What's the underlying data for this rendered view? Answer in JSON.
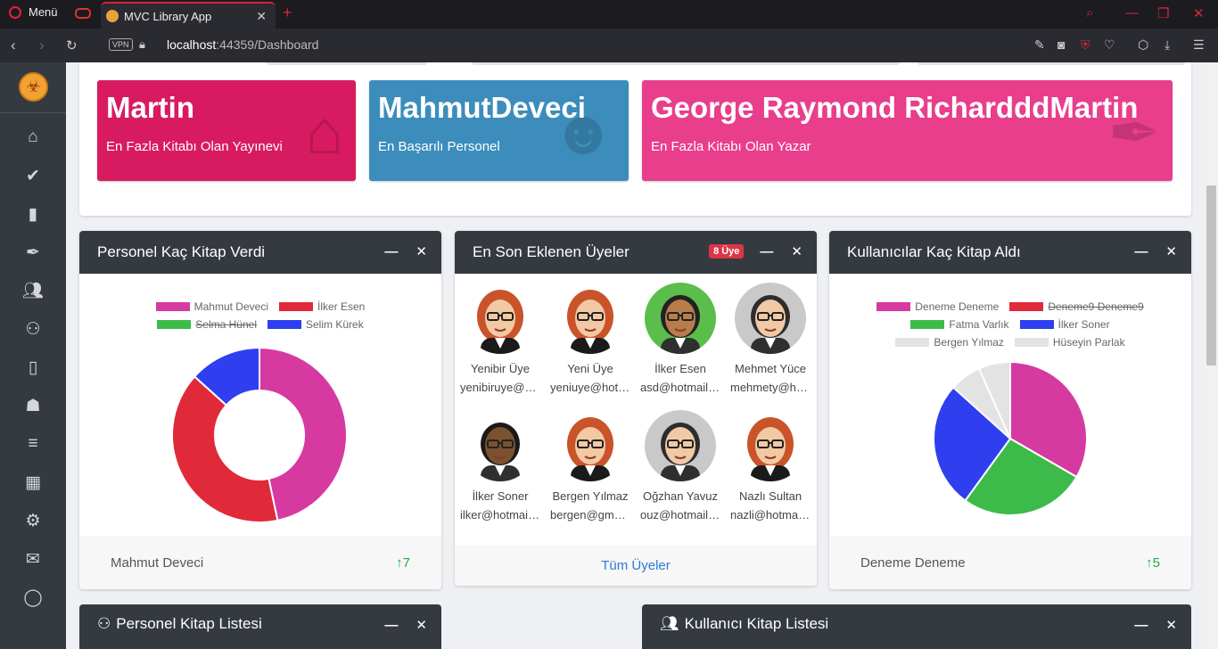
{
  "browser": {
    "menu_label": "Menü",
    "tab_title": "MVC Library App",
    "vpn_label": "VPN",
    "url_host": "localhost",
    "url_path": ":44359/Dashboard"
  },
  "sidebar": {
    "items": [
      {
        "icon": "home-icon"
      },
      {
        "icon": "check-double-icon"
      },
      {
        "icon": "book-icon"
      },
      {
        "icon": "pen-nib-icon"
      },
      {
        "icon": "users-icon"
      },
      {
        "icon": "people-carry-icon"
      },
      {
        "icon": "book-open-icon"
      },
      {
        "icon": "book-reader-icon"
      },
      {
        "icon": "list-ol-icon"
      },
      {
        "icon": "building-icon"
      },
      {
        "icon": "cogs-icon"
      },
      {
        "icon": "envelope-icon"
      },
      {
        "icon": "comment-icon"
      }
    ]
  },
  "stats": [
    {
      "value": "Martin",
      "label": "En Fazla Kitabı Olan Yayınevi",
      "color": "#d81b60",
      "icon": "home-icon"
    },
    {
      "value": "MahmutDeveci",
      "label": "En Başarılı Personel",
      "color": "#3c8dbc",
      "icon": "user-graduate-icon"
    },
    {
      "value": "George Raymond RichardddMartin",
      "label": "En Fazla Kitabı Olan Yazar",
      "color": "#e83e8c",
      "icon": "pen-nib-icon"
    }
  ],
  "personel_card": {
    "title": "Personel Kaç Kitap Verdi",
    "legend": [
      {
        "label": "Mahmut Deveci",
        "color": "#d63aa0",
        "hidden": false
      },
      {
        "label": "İlker Esen",
        "color": "#e02a3a",
        "hidden": false
      },
      {
        "label": "Selma Hünel",
        "color": "#3dbb4a",
        "hidden": true
      },
      {
        "label": "Selim Kürek",
        "color": "#2f3ff0",
        "hidden": false
      }
    ],
    "footer_name": "Mahmut Deveci",
    "footer_value": "7"
  },
  "members_card": {
    "title": "En Son Eklenen Üyeler",
    "badge": "8 Üye",
    "members": [
      {
        "name": "Yenibir Üye",
        "email": "yenibiruye@hotmail.com",
        "avatar": "female"
      },
      {
        "name": "Yeni Üye",
        "email": "yeniuye@hotmail.com",
        "avatar": "female"
      },
      {
        "name": "İlker Esen",
        "email": "asd@hotmail.com",
        "avatar": "male-green"
      },
      {
        "name": "Mehmet Yüce",
        "email": "mehmety@hotmail.com",
        "avatar": "male"
      },
      {
        "name": "İlker Soner",
        "email": "ilker@hotmail.com",
        "avatar": "male-dark"
      },
      {
        "name": "Bergen Yılmaz",
        "email": "bergen@gmail.com",
        "avatar": "female"
      },
      {
        "name": "Oğzhan Yavuz",
        "email": "ouz@hotmail.com",
        "avatar": "male"
      },
      {
        "name": "Nazlı Sultan",
        "email": "nazli@hotmail.com",
        "avatar": "female"
      }
    ],
    "footer_link": "Tüm Üyeler"
  },
  "kullanici_card": {
    "title": "Kullanıcılar Kaç Kitap Aldı",
    "legend": [
      {
        "label": "Deneme Deneme",
        "color": "#d63aa0",
        "hidden": false
      },
      {
        "label": "Deneme9 Deneme9",
        "color": "#e02a3a",
        "hidden": true
      },
      {
        "label": "Fatma Varlık",
        "color": "#3dbb4a",
        "hidden": false
      },
      {
        "label": "İlker Soner",
        "color": "#2f3ff0",
        "hidden": false
      },
      {
        "label": "Bergen Yılmaz",
        "color": "#e3e3e3",
        "hidden": false
      },
      {
        "label": "Hüseyin Parlak",
        "color": "#e3e3e3",
        "hidden": false
      }
    ],
    "footer_name": "Deneme Deneme",
    "footer_value": "5"
  },
  "bottom_cards": [
    {
      "title": "Personel Kitap Listesi",
      "icon": "people-carry-icon"
    },
    {
      "title": "Kullanıcı Kitap Listesi",
      "icon": "users-icon"
    }
  ],
  "chart_data": [
    {
      "type": "pie",
      "variant": "doughnut",
      "categories": [
        "Mahmut Deveci",
        "İlker Esen",
        "Selim Kürek"
      ],
      "values": [
        7,
        6,
        2
      ]
    },
    {
      "type": "pie",
      "categories": [
        "Deneme Deneme",
        "Fatma Varlık",
        "İlker Soner",
        "Bergen Yılmaz",
        "Hüseyin Parlak"
      ],
      "values": [
        5,
        4,
        4,
        1,
        1
      ]
    }
  ]
}
